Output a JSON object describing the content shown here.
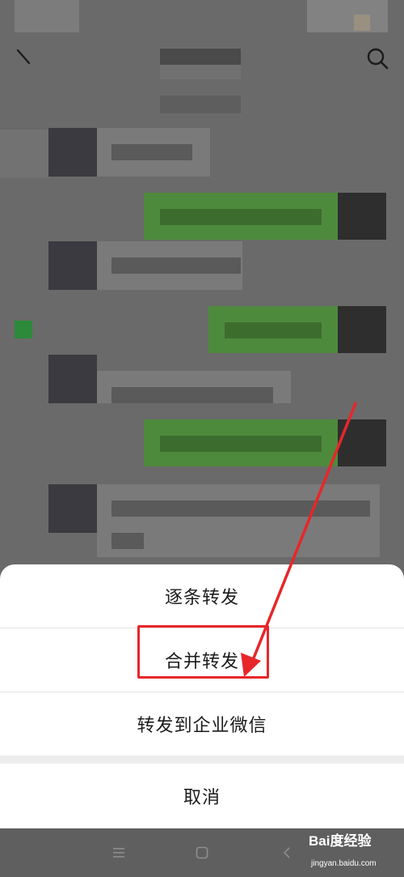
{
  "share_sheet": {
    "options": [
      {
        "label": "逐条转发"
      },
      {
        "label": "合并转发"
      },
      {
        "label": "转发到企业微信"
      }
    ],
    "cancel_label": "取消"
  },
  "watermark": {
    "brand": "Bai度经验",
    "url": "jingyan.baidu.com"
  },
  "colors": {
    "dim_overlay": "#6a6a6a",
    "message_green": "#4e8a3c",
    "annotation_red": "#e8262a"
  }
}
